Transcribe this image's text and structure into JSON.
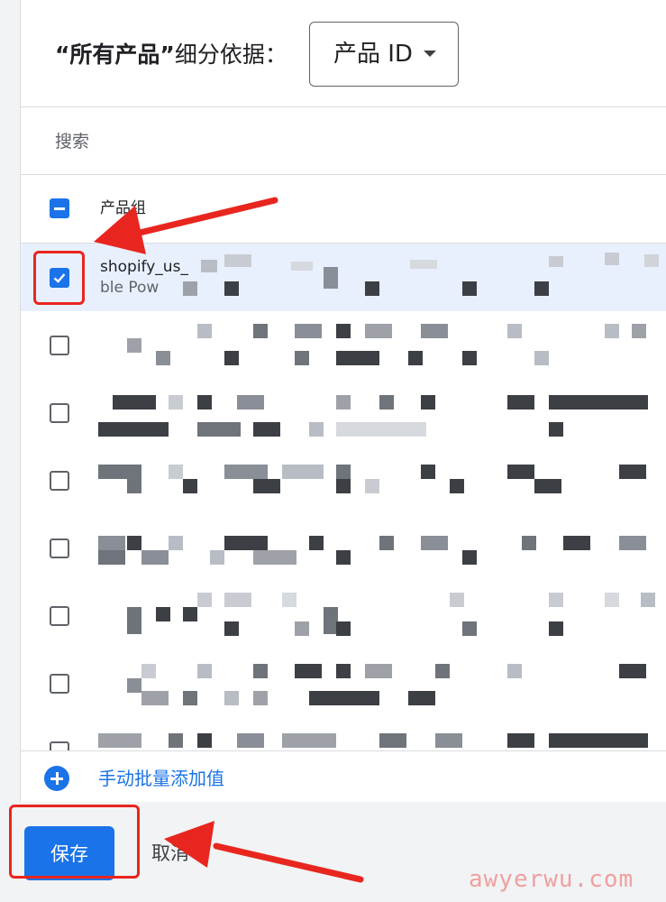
{
  "header": {
    "title_quoted": "“所有产品”",
    "title_suffix": "细分依据：",
    "dropdown_value": "产品 ID"
  },
  "search": {
    "placeholder": "搜索"
  },
  "table": {
    "column_header": "产品组",
    "select_all_state": "indeterminate",
    "rows": [
      {
        "checked": true,
        "text": "shopify_us_",
        "text2": "ble Pow"
      },
      {
        "checked": false,
        "text": ""
      },
      {
        "checked": false,
        "text": ""
      },
      {
        "checked": false,
        "text": ""
      },
      {
        "checked": false,
        "text": ""
      },
      {
        "checked": false,
        "text": ""
      },
      {
        "checked": false,
        "text": ""
      },
      {
        "checked": false,
        "text": ""
      }
    ]
  },
  "add_values": {
    "label": "手动批量添加值",
    "icon": "add-circle-icon"
  },
  "actions": {
    "save_label": "保存",
    "cancel_label": "取消"
  },
  "annotations": {
    "color": "#e8261f"
  },
  "watermark": "awyerwu.com",
  "colors": {
    "accent": "#1a73e8",
    "selected_row": "#e8f0fe"
  }
}
